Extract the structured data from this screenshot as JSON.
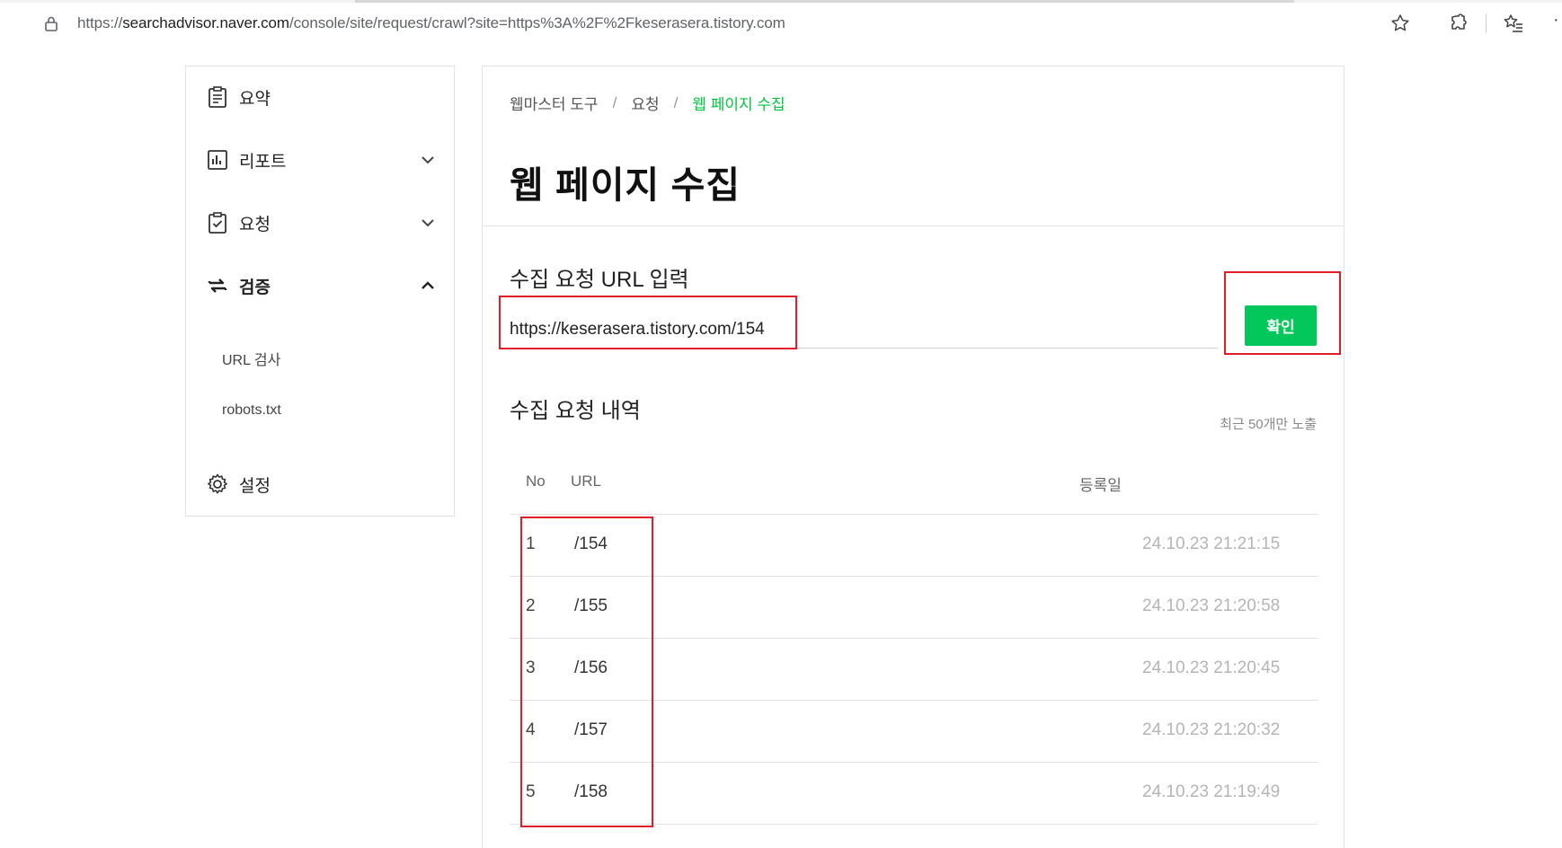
{
  "browser": {
    "url_prefix": "https://",
    "url_host": "searchadvisor.naver.com",
    "url_path": "/console/site/request/crawl?site=https%3A%2F%2Fkeserasera.tistory.com",
    "more_glyph": "·"
  },
  "sidebar": {
    "items": [
      {
        "label": "요약",
        "icon": "summary-icon"
      },
      {
        "label": "리포트",
        "icon": "report-icon"
      },
      {
        "label": "요청",
        "icon": "request-icon"
      },
      {
        "label": "검증",
        "icon": "verify-icon"
      },
      {
        "label": "설정",
        "icon": "gear-icon"
      }
    ],
    "sub_items": [
      "URL 검사",
      "robots.txt"
    ]
  },
  "main": {
    "breadcrumb": [
      "웹마스터 도구",
      "요청",
      "웹 페이지 수집"
    ],
    "breadcrumb_sep": "/",
    "title": "웹 페이지 수집",
    "input_section_title": "수집 요청 URL 입력",
    "url_input_value": "https://keserasera.tistory.com/154",
    "confirm_label": "확인",
    "history_title": "수집 요청 내역",
    "history_hint": "최근 50개만 노출",
    "table": {
      "headers": {
        "no": "No",
        "url": "URL",
        "date": "등록일"
      },
      "rows": [
        {
          "no": "1",
          "url": "/154",
          "date": "24.10.23 21:21:15"
        },
        {
          "no": "2",
          "url": "/155",
          "date": "24.10.23 21:20:58"
        },
        {
          "no": "3",
          "url": "/156",
          "date": "24.10.23 21:20:45"
        },
        {
          "no": "4",
          "url": "/157",
          "date": "24.10.23 21:20:32"
        },
        {
          "no": "5",
          "url": "/158",
          "date": "24.10.23 21:19:49"
        }
      ]
    }
  },
  "colors": {
    "accent": "#00c73c",
    "button": "#03c75a",
    "annotation": "#e11d2a"
  }
}
